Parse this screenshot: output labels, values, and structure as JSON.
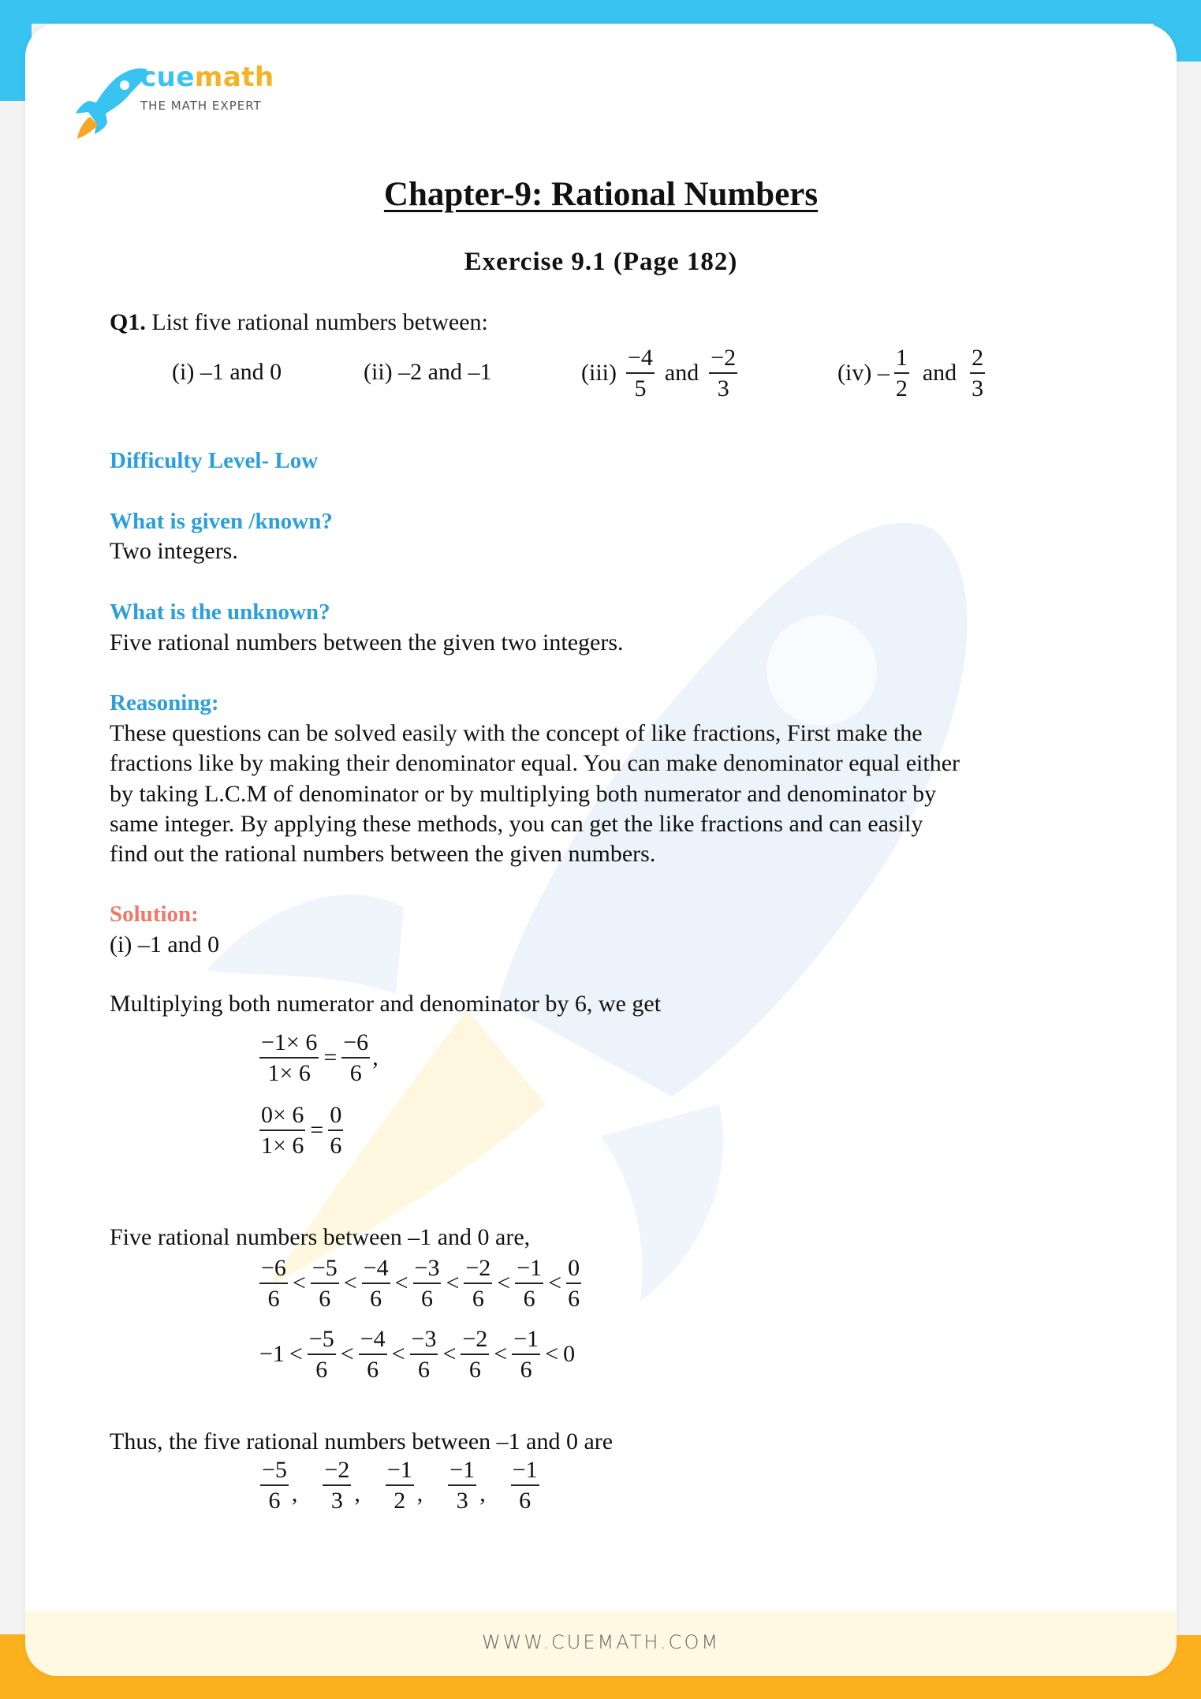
{
  "brand": {
    "name_part1": "cue",
    "name_part2": "math",
    "tagline": "THE MATH EXPERT",
    "colors": {
      "blue": "#38c3f1",
      "orange": "#fbb11e",
      "heading_blue": "#2b9fdc",
      "solution_red": "#f0786a"
    }
  },
  "header": {
    "title": "Chapter-9: Rational Numbers",
    "subtitle": "Exercise 9.1 (Page 182)"
  },
  "question": {
    "label": "Q1.",
    "text": "List five rational numbers between:",
    "parts": {
      "i": "(i) –1 and 0",
      "ii": "(ii) –2 and –1",
      "iii": {
        "label": "(iii)",
        "a_num": "−4",
        "a_den": "5",
        "and": "and",
        "b_num": "−2",
        "b_den": "3"
      },
      "iv": {
        "label": "(iv) –",
        "a_num": "1",
        "a_den": "2",
        "and": "and",
        "b_num": "2",
        "b_den": "3"
      }
    }
  },
  "difficulty": "Difficulty Level- Low",
  "given": {
    "heading": "What is given /known?",
    "text": "Two integers."
  },
  "unknown": {
    "heading": "What is the unknown?",
    "text": "Five rational numbers between the given two integers."
  },
  "reasoning": {
    "heading": "Reasoning:",
    "lines": [
      "These questions can be solved easily with the concept of like fractions, First make the",
      "fractions like by making their denominator equal. You can make denominator equal either",
      "by taking L.C.M of denominator or by multiplying both numerator and denominator by",
      "same integer. By applying these methods, you can get the like fractions and can easily",
      "find out the rational numbers between the given numbers."
    ]
  },
  "solution": {
    "heading": "Solution:",
    "part": "(i) –1 and 0",
    "step1": "Multiplying both numerator and denominator by 6, we get",
    "eq1": {
      "lhs_num": "−1× 6",
      "lhs_den": "1× 6",
      "eq": "=",
      "rhs_num": "−6",
      "rhs_den": "6",
      "tail": ","
    },
    "eq2": {
      "lhs_num": "0× 6",
      "lhs_den": "1× 6",
      "eq": "=",
      "rhs_num": "0",
      "rhs_den": "6"
    },
    "step2": "Five rational numbers between –1 and 0 are,",
    "chain1": [
      {
        "num": "−6",
        "den": "6"
      },
      {
        "num": "−5",
        "den": "6"
      },
      {
        "num": "−4",
        "den": "6"
      },
      {
        "num": "−3",
        "den": "6"
      },
      {
        "num": "−2",
        "den": "6"
      },
      {
        "num": "−1",
        "den": "6"
      },
      {
        "num": "0",
        "den": "6"
      }
    ],
    "chain2": {
      "start": "−1",
      "fracs": [
        {
          "num": "−5",
          "den": "6"
        },
        {
          "num": "−4",
          "den": "6"
        },
        {
          "num": "−3",
          "den": "6"
        },
        {
          "num": "−2",
          "den": "6"
        },
        {
          "num": "−1",
          "den": "6"
        }
      ],
      "end": "0"
    },
    "lt": "<",
    "conclusion": "Thus, the five rational numbers between –1 and 0 are",
    "answers": [
      {
        "num": "−5",
        "den": "6"
      },
      {
        "num": "−2",
        "den": "3"
      },
      {
        "num": "−1",
        "den": "2"
      },
      {
        "num": "−1",
        "den": "3"
      },
      {
        "num": "−1",
        "den": "6"
      }
    ],
    "sep": ","
  },
  "footer": {
    "url": "WWW.CUEMATH.COM"
  }
}
